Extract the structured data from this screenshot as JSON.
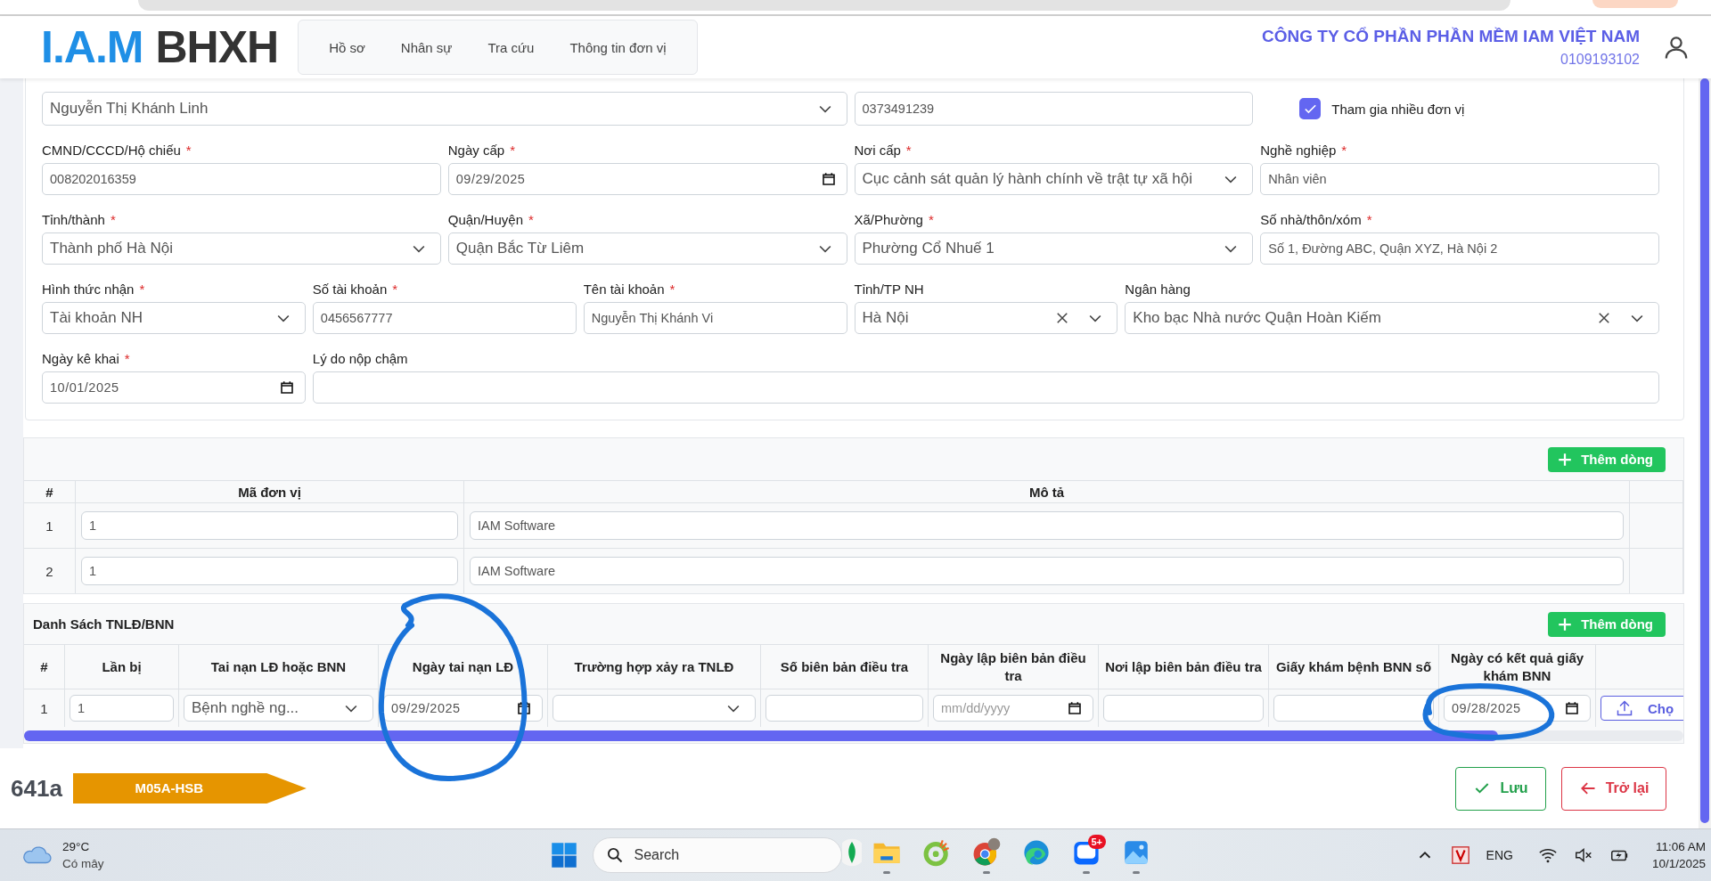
{
  "header": {
    "logo_primary": "I.A.M",
    "logo_secondary": "BHXH",
    "nav": [
      {
        "label": "Hồ sơ",
        "selected": false
      },
      {
        "label": "Nhân sự",
        "selected": false
      },
      {
        "label": "Tra cứu",
        "selected": false
      },
      {
        "label": "Thông tin đơn vị",
        "selected": false
      }
    ],
    "company": "CÔNG TY CỔ PHẦN PHẦN MỀM IAM VIỆT NAM",
    "tax_code": "0109193102"
  },
  "form": {
    "fields": [
      {
        "kind": "select",
        "value": "Nguyễn Thị Khánh Linh"
      },
      {
        "kind": "text",
        "value": "0373491239"
      },
      {
        "kind": "checkbox",
        "label": "Tham gia nhiều đơn vị",
        "checked": true
      },
      {
        "kind": "text",
        "label": "CMND/CCCD/Hộ chiếu",
        "required_mark": "*",
        "value": "008202016359"
      },
      {
        "kind": "date",
        "label": "Ngày cấp",
        "required_mark": "*",
        "value": "09/29/2025"
      },
      {
        "kind": "select",
        "label": "Nơi cấp",
        "required_mark": "*",
        "value": "Cục cảnh sát quản lý hành chính về trật tự xã hội"
      },
      {
        "kind": "text",
        "label": "Nghề nghiệp",
        "required_mark": "*",
        "value": "Nhân viên"
      },
      {
        "kind": "select",
        "label": "Tỉnh/thành",
        "required_mark": "*",
        "value": "Thành phố Hà Nội"
      },
      {
        "kind": "select",
        "label": "Quận/Huyện",
        "required_mark": "*",
        "value": "Quận Bắc Từ Liêm"
      },
      {
        "kind": "select",
        "label": "Xã/Phường",
        "required_mark": "*",
        "value": "Phường Cổ Nhuế 1"
      },
      {
        "kind": "text",
        "label": "Số nhà/thôn/xóm",
        "required_mark": "*",
        "value": "Số 1, Đường ABC, Quận XYZ, Hà Nội 2"
      },
      {
        "kind": "select",
        "label": "Hình thức nhận",
        "required_mark": "*",
        "value": "Tài khoản NH"
      },
      {
        "kind": "text",
        "label": "Số tài khoản",
        "required_mark": "*",
        "value": "0456567777"
      },
      {
        "kind": "text",
        "label": "Tên tài khoản",
        "required_mark": "*",
        "value": "Nguyễn Thị Khánh Vi"
      },
      {
        "kind": "select",
        "label": "Tỉnh/TP NH",
        "value": "Hà Nội",
        "clearable": true
      },
      {
        "kind": "select",
        "label": "Ngân hàng",
        "value": "Kho bạc Nhà nước Quận Hoàn Kiếm",
        "clearable": true
      },
      {
        "kind": "date",
        "label": "Ngày kê khai",
        "required_mark": "*",
        "value": "10/01/2025"
      },
      {
        "kind": "text",
        "label": "Lý do nộp chậm"
      }
    ]
  },
  "units_table": {
    "add_button": "Thêm dòng",
    "columns": [
      "#",
      "Mã đơn vị",
      "Mô tả"
    ],
    "rows": [
      {
        "index": "1",
        "code": "1",
        "description": "IAM Software"
      },
      {
        "index": "2",
        "code": "1",
        "description": "IAM Software"
      }
    ]
  },
  "accidents_table": {
    "title": "Danh Sách TNLĐ/BNN",
    "add_button": "Thêm dòng",
    "columns": [
      "#",
      "Lần bị",
      "Tai nạn LĐ hoặc BNN",
      "Ngày tai nạn LĐ",
      "Trường hợp xảy ra TNLĐ",
      "Số biên bản điều tra",
      "Ngày lập biên bản điều tra",
      "Nơi lập biên bản điều tra",
      "Giấy khám bệnh BNN số",
      "Ngày có kết quả giấy khám BNN"
    ],
    "rows": [
      {
        "cells": [
          {
            "kind": "index",
            "value": "1"
          },
          {
            "kind": "text",
            "value": "1"
          },
          {
            "kind": "select",
            "value": "Bệnh nghề ng..."
          },
          {
            "kind": "date",
            "value": "09/29/2025"
          },
          {
            "kind": "select"
          },
          {
            "kind": "text"
          },
          {
            "kind": "date",
            "placeholder": "mm/dd/yyyy"
          },
          {
            "kind": "text"
          },
          {
            "kind": "text"
          },
          {
            "kind": "date",
            "value": "09/28/2025"
          },
          {
            "kind": "upload",
            "label": "Chọ"
          }
        ]
      }
    ]
  },
  "footer": {
    "code": "641a",
    "tag": "M05A-HSB",
    "buttons": [
      {
        "kind": "save",
        "label": "Lưu"
      },
      {
        "kind": "back",
        "label": "Trở lại"
      }
    ]
  },
  "taskbar": {
    "weather": {
      "temperature": "29°C",
      "condition": "Có mây"
    },
    "search_placeholder": "Search",
    "apps": [
      {
        "kind": "leaf",
        "running": false
      },
      {
        "kind": "folder",
        "running": true
      },
      {
        "kind": "ring",
        "running": false
      },
      {
        "kind": "chrome",
        "running": true
      },
      {
        "kind": "edge",
        "running": false
      },
      {
        "kind": "chat",
        "running": true,
        "badge": "5+"
      },
      {
        "kind": "photos",
        "running": true
      }
    ],
    "language": "ENG",
    "time": "11:06 AM",
    "date": "10/1/2025"
  }
}
